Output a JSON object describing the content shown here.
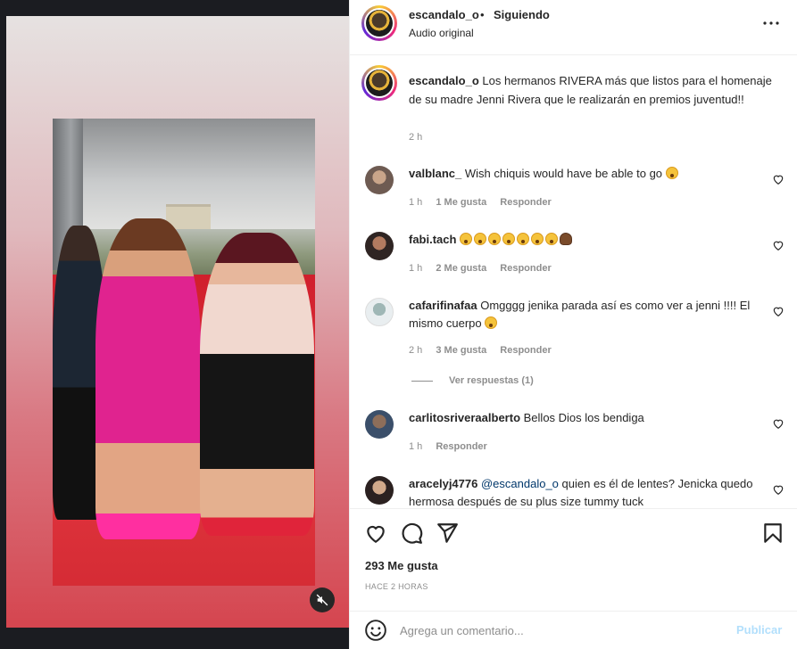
{
  "post": {
    "username": "escandalo_o",
    "separator": "•",
    "follow_status": "Siguiendo",
    "audio": "Audio original",
    "caption_user": "escandalo_o",
    "caption_text": "Los hermanos RIVERA más que listos para el homenaje de su madre Jenni Rivera que le realizarán en premios juventud!!",
    "caption_time": "2 h",
    "likes": "293 Me gusta",
    "posted_ago": "HACE 2 HORAS",
    "video_muted": true
  },
  "comments": [
    {
      "user": "valblanc_",
      "text": "Wish chiquis would have be able to go",
      "time": "1 h",
      "likes": "1 Me gusta",
      "reply": "Responder",
      "emojis": [
        "sad-face"
      ]
    },
    {
      "user": "fabi.tach",
      "text": "",
      "time": "1 h",
      "likes": "2 Me gusta",
      "reply": "Responder",
      "emojis": [
        "astonished-face",
        "astonished-face",
        "astonished-face",
        "astonished-face",
        "astonished-face",
        "astonished-face",
        "astonished-face",
        "poo"
      ]
    },
    {
      "user": "cafarifinafaa",
      "text": "Omgggg jenika parada así es como ver a jenni !!!! El mismo cuerpo",
      "time": "2 h",
      "likes": "3 Me gusta",
      "reply": "Responder",
      "emojis": [
        "crying-face"
      ],
      "view_replies": "Ver respuestas (1)"
    },
    {
      "user": "carlitosriveraalberto",
      "text": "Bellos Dios los bendiga",
      "time": "1 h",
      "likes": "",
      "reply": "Responder"
    },
    {
      "user": "aracelyj4776",
      "mention": "@escandalo_o",
      "text": "quien es él de lentes? Jenicka quedo hermosa después de su plus size tummy tuck",
      "time": "",
      "likes": "",
      "reply": ""
    }
  ],
  "add_comment": {
    "placeholder": "Agrega un comentario...",
    "publish": "Publicar"
  },
  "colors": {
    "link": "#00376b",
    "muted_text": "#8e8e8e",
    "publish_disabled": "#b2dffc",
    "carpet_red": "#d01f2c",
    "dress_pink": "#e0238f"
  }
}
